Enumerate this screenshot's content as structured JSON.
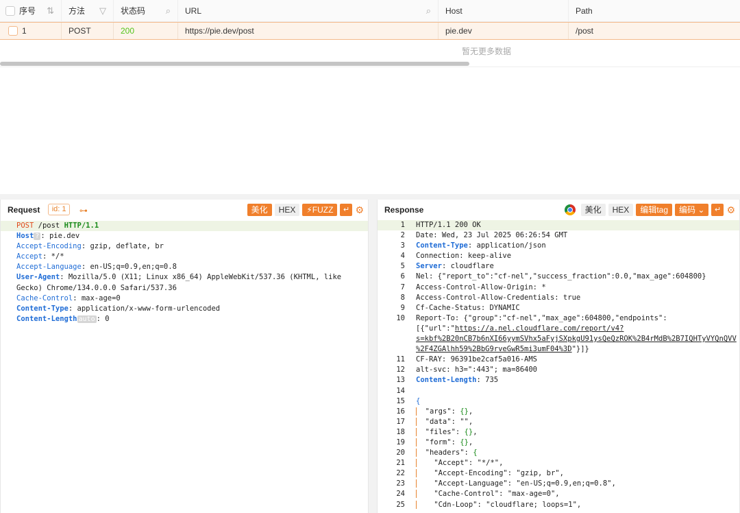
{
  "table": {
    "columns": [
      {
        "label": "序号",
        "icon": "sort-icon"
      },
      {
        "label": "方法",
        "icon": "filter-icon"
      },
      {
        "label": "状态码",
        "icon": "search-icon"
      },
      {
        "label": "URL",
        "icon": "search-icon"
      },
      {
        "label": "Host"
      },
      {
        "label": "Path"
      }
    ],
    "rows": [
      {
        "index": "1",
        "method": "POST",
        "status": "200",
        "url": "https://pie.dev/post",
        "host": "pie.dev",
        "path": "/post"
      }
    ],
    "no_more": "暂无更多数据",
    "status_color": "#52c41a"
  },
  "request": {
    "title": "Request",
    "id_label": "id: 1",
    "tools": {
      "beautify": "美化",
      "hex": "HEX",
      "fuzz": "FUZZ"
    },
    "lines": [
      {
        "parts": [
          [
            "POST",
            "red"
          ],
          [
            " /post ",
            ""
          ],
          [
            "HTTP/1.1",
            "grn"
          ]
        ]
      },
      {
        "parts": [
          [
            "Host",
            "bblue"
          ],
          [
            "?",
            "chip"
          ],
          [
            ": pie.dev",
            ""
          ]
        ]
      },
      {
        "parts": [
          [
            "Accept-Encoding",
            "blue"
          ],
          [
            ": gzip, deflate, br",
            ""
          ]
        ]
      },
      {
        "parts": [
          [
            "Accept",
            "blue"
          ],
          [
            ": */*",
            ""
          ]
        ]
      },
      {
        "parts": [
          [
            "Accept-Language",
            "blue"
          ],
          [
            ": en-US;q=0.9,en;q=0.8",
            ""
          ]
        ]
      },
      {
        "parts": [
          [
            "User-Agent",
            "bblue"
          ],
          [
            ": Mozilla/5.0 (X11; Linux x86_64) AppleWebKit/537.36 (KHTML, like",
            ""
          ]
        ]
      },
      {
        "parts": [
          [
            "Gecko) Chrome/134.0.0.0 Safari/537.36",
            ""
          ]
        ]
      },
      {
        "parts": [
          [
            "Cache-Control",
            "blue"
          ],
          [
            ": max-age=0",
            ""
          ]
        ]
      },
      {
        "parts": [
          [
            "Content-Type",
            "bblue"
          ],
          [
            ": application/x-www-form-urlencoded",
            ""
          ]
        ]
      },
      {
        "parts": [
          [
            "Content-Length",
            "bblue"
          ],
          [
            "auto",
            "chip"
          ],
          [
            ": 0",
            ""
          ]
        ]
      }
    ]
  },
  "response": {
    "title": "Response",
    "tools": {
      "beautify": "美化",
      "hex": "HEX",
      "edit_tag": "编辑tag",
      "encode": "编码"
    },
    "lines": [
      {
        "n": "1",
        "parts": [
          [
            "HTTP/1.1 200 OK",
            ""
          ]
        ]
      },
      {
        "n": "2",
        "parts": [
          [
            "Date: Wed, 23 Jul 2025 06:26:54 GMT",
            ""
          ]
        ]
      },
      {
        "n": "3",
        "parts": [
          [
            "Content-Type",
            "bblue"
          ],
          [
            ": application/json",
            ""
          ]
        ]
      },
      {
        "n": "4",
        "parts": [
          [
            "Connection: keep-alive",
            ""
          ]
        ]
      },
      {
        "n": "5",
        "parts": [
          [
            "Server",
            "bblue"
          ],
          [
            ": cloudflare",
            ""
          ]
        ]
      },
      {
        "n": "6",
        "parts": [
          [
            "Nel: {\"report_to\":\"cf-nel\",\"success_fraction\":0.0,\"max_age\":604800}",
            ""
          ]
        ]
      },
      {
        "n": "7",
        "parts": [
          [
            "Access-Control-Allow-Origin: *",
            ""
          ]
        ]
      },
      {
        "n": "8",
        "parts": [
          [
            "Access-Control-Allow-Credentials: true",
            ""
          ]
        ]
      },
      {
        "n": "9",
        "parts": [
          [
            "Cf-Cache-Status: DYNAMIC",
            ""
          ]
        ]
      },
      {
        "n": "10",
        "parts": [
          [
            "Report-To: {\"group\":\"cf-nel\",\"max_age\":604800,\"endpoints\":",
            ""
          ]
        ]
      },
      {
        "n": "",
        "parts": [
          [
            "[{\"url\":\"",
            ""
          ],
          [
            "https://a.nel.cloudflare.com/report/v4?",
            "ul"
          ]
        ]
      },
      {
        "n": "",
        "parts": [
          [
            "s=kbf%2B20nCB7b6nXI66yymSVhx5aFyjSXpkgU91ysQeQzROK%2B4rMdB%2B7IQHTyVYQnQVV",
            "ul"
          ]
        ]
      },
      {
        "n": "",
        "parts": [
          [
            "%2F4ZGAlhh59%2BbG9rveGwR5mi3umF04%3D",
            "ul"
          ],
          [
            "\"}]}",
            ""
          ]
        ]
      },
      {
        "n": "11",
        "parts": [
          [
            "CF-RAY: 96391be2caf5a016-AMS",
            ""
          ]
        ]
      },
      {
        "n": "12",
        "parts": [
          [
            "alt-svc: h3=\":443\"; ma=86400",
            ""
          ]
        ]
      },
      {
        "n": "13",
        "parts": [
          [
            "Content-Length",
            "bblue"
          ],
          [
            ": 735",
            ""
          ]
        ]
      },
      {
        "n": "14",
        "parts": [
          [
            "",
            ""
          ]
        ]
      },
      {
        "n": "15",
        "parts": [
          [
            "{",
            "blue"
          ]
        ]
      },
      {
        "n": "16",
        "parts": [
          [
            "  \"args\": ",
            ""
          ],
          [
            "{}",
            "num"
          ],
          [
            ",",
            ""
          ]
        ],
        "ind": 1
      },
      {
        "n": "17",
        "parts": [
          [
            "  \"data\": \"\",",
            ""
          ]
        ],
        "ind": 1
      },
      {
        "n": "18",
        "parts": [
          [
            "  \"files\": ",
            ""
          ],
          [
            "{}",
            "num"
          ],
          [
            ",",
            ""
          ]
        ],
        "ind": 1
      },
      {
        "n": "19",
        "parts": [
          [
            "  \"form\": ",
            ""
          ],
          [
            "{}",
            "num"
          ],
          [
            ",",
            ""
          ]
        ],
        "ind": 1
      },
      {
        "n": "20",
        "parts": [
          [
            "  \"headers\": ",
            ""
          ],
          [
            "{",
            "num"
          ]
        ],
        "ind": 1
      },
      {
        "n": "21",
        "parts": [
          [
            "    \"Accept\": \"*/*\",",
            ""
          ]
        ],
        "ind": 1
      },
      {
        "n": "22",
        "parts": [
          [
            "    \"Accept-Encoding\": \"gzip, br\",",
            ""
          ]
        ],
        "ind": 1
      },
      {
        "n": "23",
        "parts": [
          [
            "    \"Accept-Language\": \"en-US;q=0.9,en;q=0.8\",",
            ""
          ]
        ],
        "ind": 1
      },
      {
        "n": "24",
        "parts": [
          [
            "    \"Cache-Control\": \"max-age=0\",",
            ""
          ]
        ],
        "ind": 1
      },
      {
        "n": "25",
        "parts": [
          [
            "    \"Cdn-Loop\": \"cloudflare; loops=1\",",
            ""
          ]
        ],
        "ind": 1
      }
    ]
  }
}
